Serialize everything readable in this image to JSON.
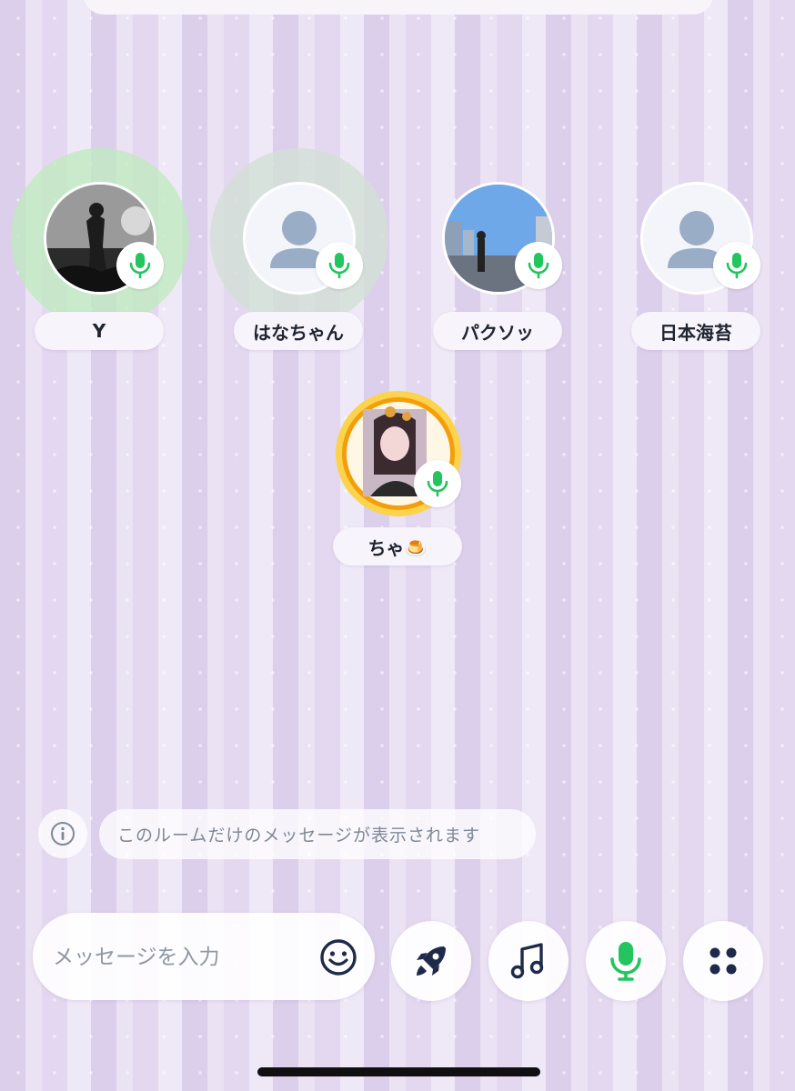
{
  "colors": {
    "mic_green": "#22c55e",
    "icon_navy": "#1e2a4a",
    "placeholder_avatar": "#9aadc6"
  },
  "speakers": [
    {
      "name": "Y",
      "avatar": "photo-concert",
      "speaking": true
    },
    {
      "name": "はなちゃん",
      "avatar": "default-person",
      "speaking": true
    },
    {
      "name": "パクソッ",
      "avatar": "photo-city",
      "speaking": false
    },
    {
      "name": "日本海苔",
      "avatar": "default-person",
      "speaking": false
    }
  ],
  "host": {
    "name": "ちゃ🍮",
    "avatar": "photo-selfie-gold-frame"
  },
  "info": {
    "icon": "info-circle-icon",
    "text": "このルームだけのメッセージが表示されます"
  },
  "composer": {
    "placeholder": "メッセージを入力",
    "emoji_icon": "smiley-icon",
    "buttons": [
      "rocket-icon",
      "music-note-icon",
      "microphone-icon",
      "grid-dots-icon"
    ]
  }
}
